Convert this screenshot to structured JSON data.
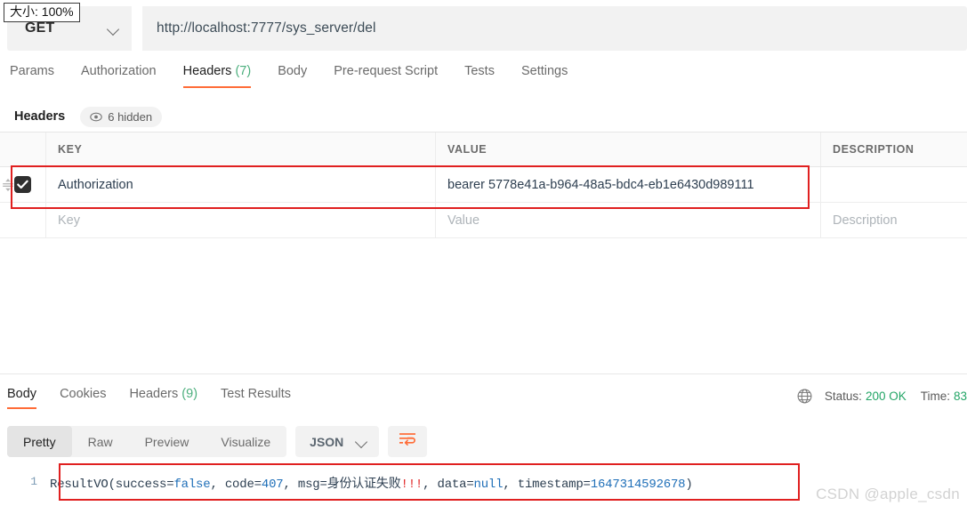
{
  "overlay": {
    "zoom_badge": "大小: 100%"
  },
  "request": {
    "method": "GET",
    "method_chevron_icon": "chevron-down-icon",
    "url": "http://localhost:7777/sys_server/del",
    "tabs": [
      {
        "label": "Params",
        "count": "",
        "active": false
      },
      {
        "label": "Authorization",
        "count": "",
        "active": false
      },
      {
        "label": "Headers",
        "count": "(7)",
        "active": true
      },
      {
        "label": "Body",
        "count": "",
        "active": false
      },
      {
        "label": "Pre-request Script",
        "count": "",
        "active": false
      },
      {
        "label": "Tests",
        "count": "",
        "active": false
      },
      {
        "label": "Settings",
        "count": "",
        "active": false
      }
    ],
    "headers_section": {
      "title": "Headers",
      "hidden_pill": "6 hidden",
      "hidden_pill_icon": "eye-icon",
      "columns": [
        "KEY",
        "VALUE",
        "DESCRIPTION"
      ],
      "rows": [
        {
          "checked": true,
          "key": "Authorization",
          "value": "bearer 5778e41a-b964-48a5-bdc4-eb1e6430d989111",
          "description": ""
        }
      ],
      "placeholder_row": {
        "key": "Key",
        "value": "Value",
        "description": "Description"
      }
    }
  },
  "response": {
    "tabs": [
      {
        "label": "Body",
        "count": "",
        "active": true
      },
      {
        "label": "Cookies",
        "count": "",
        "active": false
      },
      {
        "label": "Headers",
        "count": "(9)",
        "active": false
      },
      {
        "label": "Test Results",
        "count": "",
        "active": false
      }
    ],
    "meta": {
      "globe_icon": "globe-icon",
      "status_label": "Status:",
      "status_value": "200 OK",
      "time_label": "Time:",
      "time_value": "83"
    },
    "view_modes": [
      {
        "label": "Pretty",
        "active": true
      },
      {
        "label": "Raw",
        "active": false
      },
      {
        "label": "Preview",
        "active": false
      },
      {
        "label": "Visualize",
        "active": false
      }
    ],
    "format": "JSON",
    "format_chevron_icon": "chevron-down-icon",
    "wrap_button_icon": "wrap-lines-icon",
    "body": {
      "line_number": "1",
      "prefix": "ResultVO(success=",
      "false_kw": "false",
      "mid1": ", code=",
      "code": "407",
      "mid2": ", msg=身份认证失败",
      "bangs": "!!!",
      "mid3": ", data=",
      "null_kw": "null",
      "mid4": ", timestamp=",
      "timestamp": "1647314592678",
      "suffix": ")",
      "full_text": "ResultVO(success=false, code=407, msg=身份认证失败!!!, data=null, timestamp=1647314592678)"
    }
  },
  "watermark": "CSDN @apple_csdn",
  "colors": {
    "accent": "#ff6c37",
    "success": "#23a566",
    "annotation": "#e02020",
    "panel": "#f2f2f2"
  }
}
